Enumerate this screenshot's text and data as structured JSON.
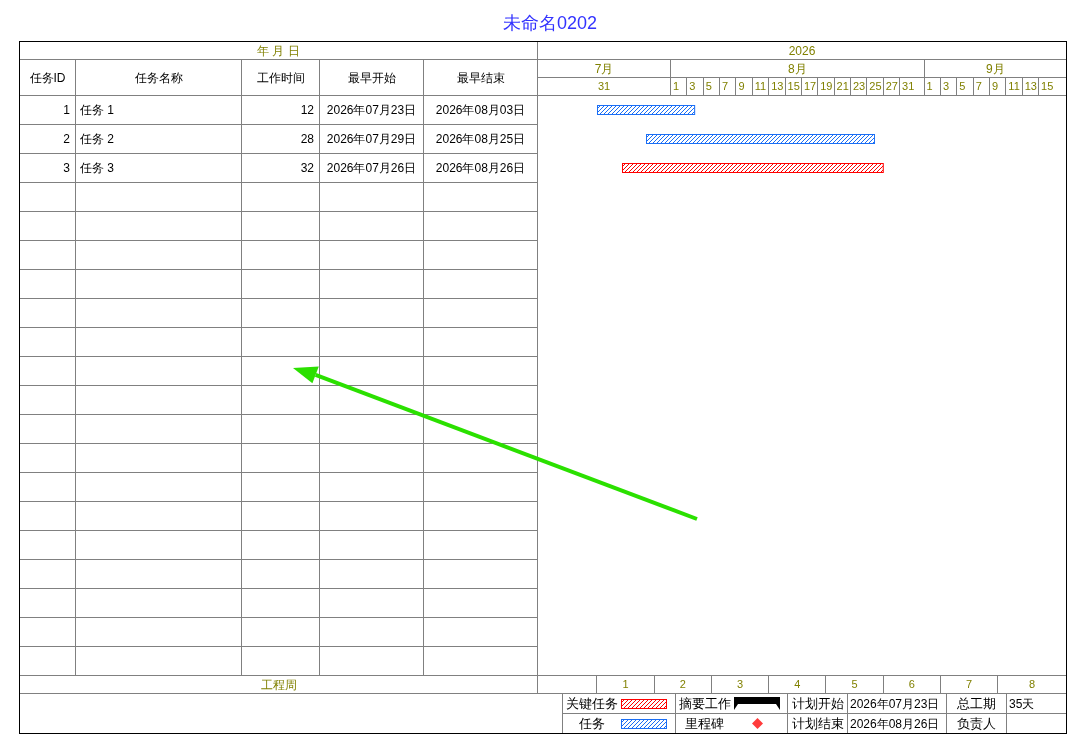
{
  "title": "未命名0202",
  "table": {
    "date_header": "年 月 日",
    "columns": [
      "任务ID",
      "任务名称",
      "工作时间",
      "最早开始",
      "最早结束"
    ],
    "rows": [
      {
        "id": "1",
        "name": "任务 1",
        "duration": "12",
        "start": "2026年07月23日",
        "end": "2026年08月03日",
        "critical": false
      },
      {
        "id": "2",
        "name": "任务 2",
        "duration": "28",
        "start": "2026年07月29日",
        "end": "2026年08月25日",
        "critical": false
      },
      {
        "id": "3",
        "name": "任务 3",
        "duration": "32",
        "start": "2026年07月26日",
        "end": "2026年08月26日",
        "critical": true
      }
    ],
    "footer": "工程周"
  },
  "timeline": {
    "year": "2026",
    "months": [
      {
        "label": "7月",
        "days": [
          "31"
        ]
      },
      {
        "label": "8月",
        "days": [
          "1",
          "3",
          "5",
          "7",
          "9",
          "11",
          "13",
          "15",
          "17",
          "19",
          "21",
          "23",
          "25",
          "27",
          "31"
        ]
      },
      {
        "label": "9月",
        "days": [
          "1",
          "3",
          "5",
          "7",
          "9",
          "11",
          "13",
          "15"
        ]
      }
    ],
    "weeks": [
      "1",
      "2",
      "3",
      "4",
      "5",
      "6",
      "7",
      "8"
    ]
  },
  "legend": {
    "items": [
      {
        "kind": "critical",
        "label": "关键任务"
      },
      {
        "kind": "summary",
        "label": "摘要工作"
      },
      {
        "kind": "task",
        "label": "任务"
      },
      {
        "kind": "milestone",
        "label": "里程碑"
      }
    ],
    "plan_start": {
      "label": "计划开始",
      "value": "2026年07月23日"
    },
    "total_duration": {
      "label": "总工期",
      "value": "35天"
    },
    "plan_end": {
      "label": "计划结束",
      "value": "2026年08月26日"
    },
    "owner": {
      "label": "负责人"
    }
  }
}
